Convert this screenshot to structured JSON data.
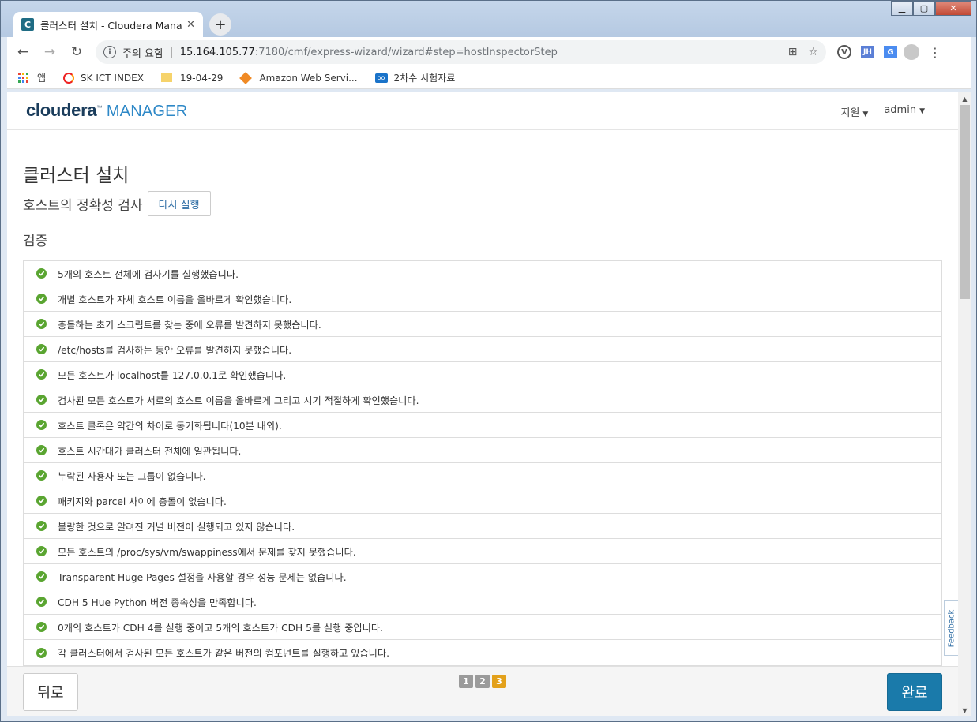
{
  "browser": {
    "tab_title": "클러스터 설치 - Cloudera Mana",
    "tab_favicon": "C",
    "tab_close": "✕",
    "new_tab": "+",
    "security_label": "주의 요함",
    "url_host": "15.164.105.77",
    "url_rest": ":7180/cmf/express-wizard/wizard#step=hostInspectorStep",
    "ext_v": "V",
    "ext_jh": "JH",
    "ext_gt": "G",
    "bookmarks": [
      {
        "label": "앱",
        "icon": "apps-grid-icon"
      },
      {
        "label": "SK ICT INDEX",
        "icon": "sk-logo-icon"
      },
      {
        "label": "19-04-29",
        "icon": "folder-icon"
      },
      {
        "label": "Amazon Web Servi...",
        "icon": "aws-icon"
      },
      {
        "label": "2차수 시험자료",
        "icon": "oo-icon"
      }
    ]
  },
  "header": {
    "logo_brand": "cloudera",
    "logo_product": "MANAGER",
    "nav_support": "지원",
    "nav_user": "admin"
  },
  "page": {
    "title": "클러스터 설치",
    "subtitle": "호스트의 정확성 검사",
    "rerun_button": "다시 실행",
    "section": "검증",
    "checks": [
      "5개의 호스트 전체에 검사기를 실행했습니다.",
      "개별 호스트가 자체 호스트 이름을 올바르게 확인했습니다.",
      "충돌하는 초기 스크립트를 찾는 중에 오류를 발견하지 못했습니다.",
      "/etc/hosts를 검사하는 동안 오류를 발견하지 못했습니다.",
      "모든 호스트가 localhost를 127.0.0.1로 확인했습니다.",
      "검사된 모든 호스트가 서로의 호스트 이름을 올바르게 그리고 시기 적절하게 확인했습니다.",
      "호스트 클록은 약간의 차이로 동기화됩니다(10분 내외).",
      "호스트 시간대가 클러스터 전체에 일관됩니다.",
      "누락된 사용자 또는 그룹이 없습니다.",
      "패키지와 parcel 사이에 충돌이 없습니다.",
      "불량한 것으로 알려진 커널 버전이 실행되고 있지 않습니다.",
      "모든 호스트의 /proc/sys/vm/swappiness에서 문제를 찾지 못했습니다.",
      "Transparent Huge Pages 설정을 사용할 경우 성능 문제는 없습니다.",
      "CDH 5 Hue Python 버전 종속성을 만족합니다.",
      "0개의 호스트가 CDH 4를 실행 중이고 5개의 호스트가 CDH 5를 실행 중입니다.",
      "각 클러스터에서 검사된 모든 호스트가 같은 버전의 컴포넌트를 실행하고 있습니다."
    ]
  },
  "footer": {
    "back_button": "뒤로",
    "pages": [
      "1",
      "2",
      "3"
    ],
    "active_page": "3",
    "done_button": "완료"
  },
  "feedback_tab": "Feedback",
  "colors": {
    "ok_green": "#5aa531",
    "primary_blue": "#1a7aaa",
    "active_page": "#e3a11b"
  }
}
